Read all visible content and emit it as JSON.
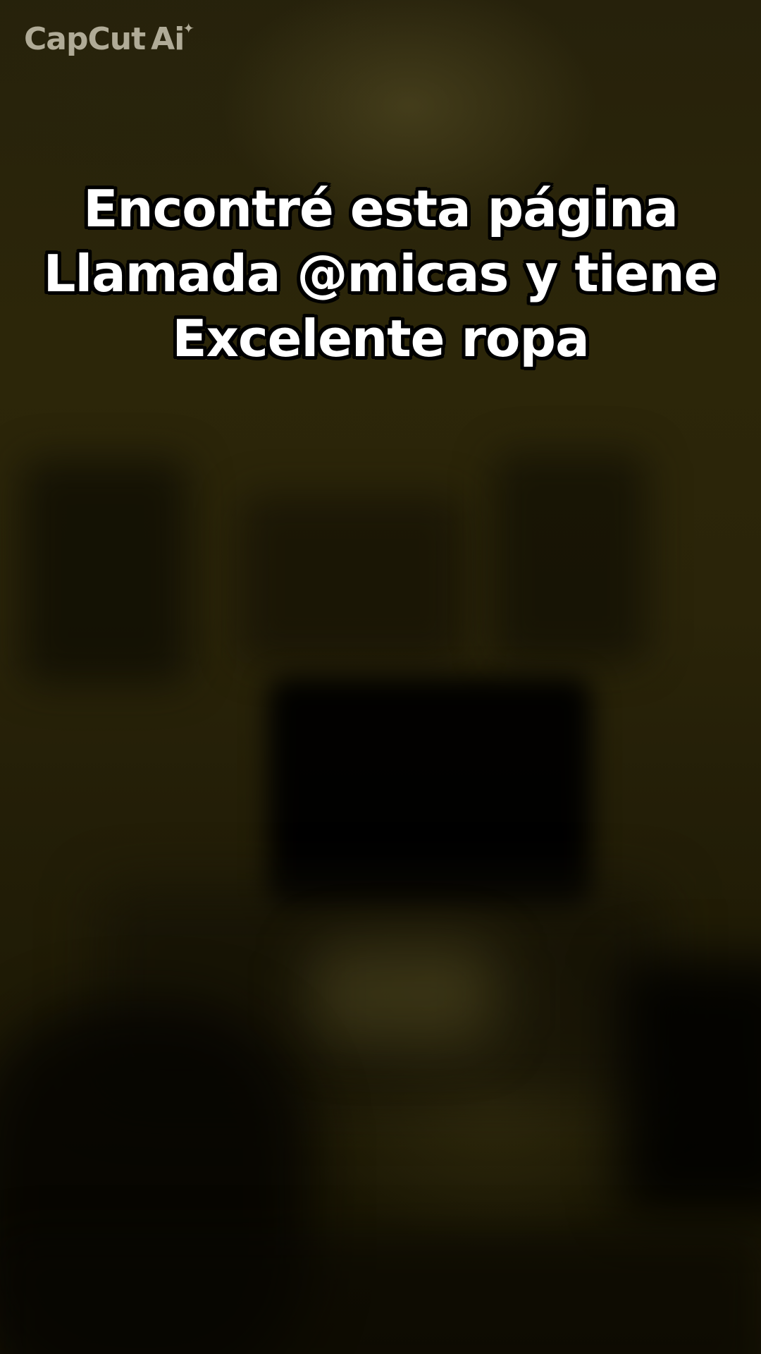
{
  "watermark": {
    "text": "CapCut",
    "suffix": "Ai",
    "sparkle_icon": "sparkle-icon"
  },
  "caption": {
    "lines": [
      "Encontré esta página",
      "Llamada @micas y tiene",
      "Excelente ropa"
    ]
  },
  "colors": {
    "caption_text": "#ffffff",
    "caption_outline": "#000000",
    "watermark": "#c9c3b0"
  }
}
